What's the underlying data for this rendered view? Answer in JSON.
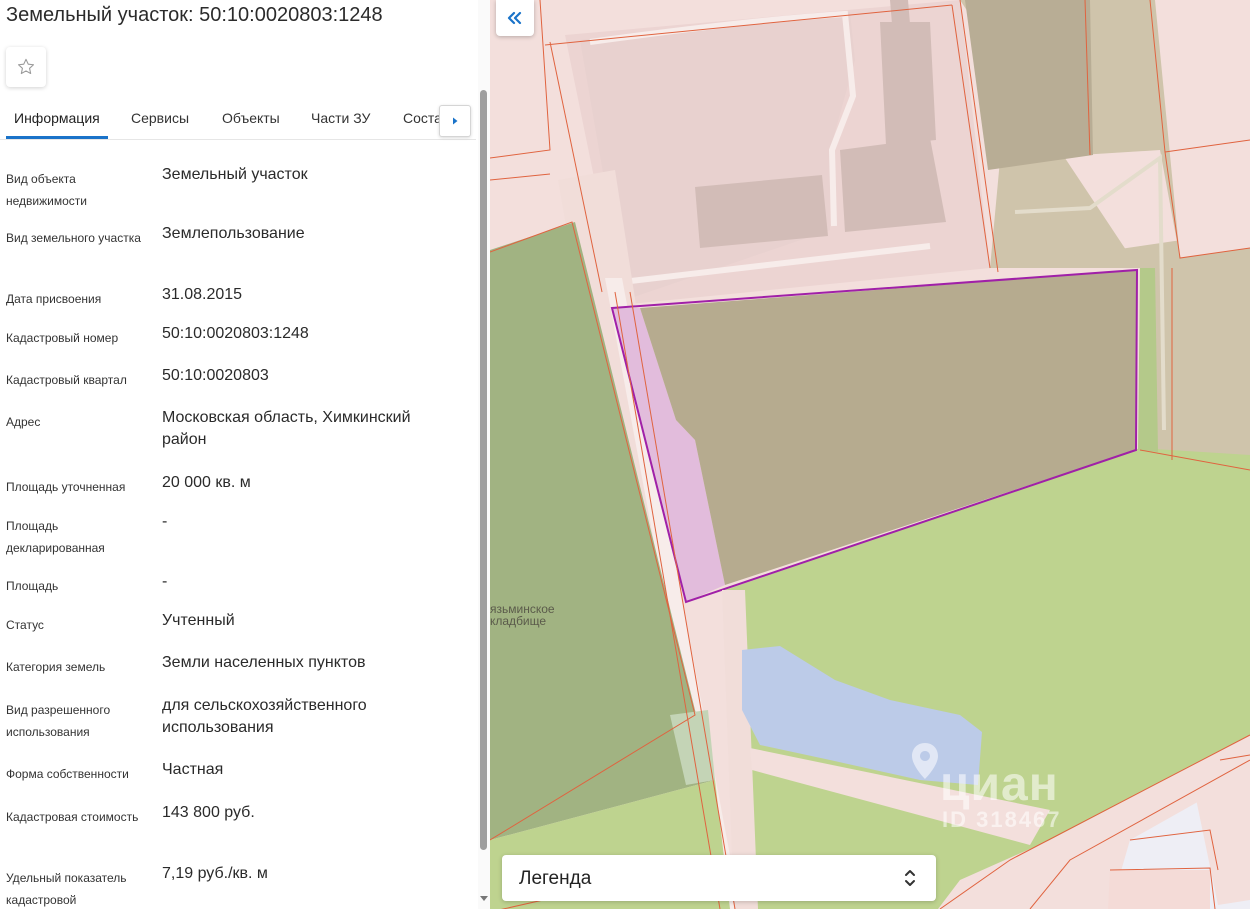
{
  "header": {
    "title": "Земельный участок: 50:10:0020803:1248"
  },
  "tabs": [
    {
      "label": "Информация",
      "active": true
    },
    {
      "label": "Сервисы"
    },
    {
      "label": "Объекты"
    },
    {
      "label": "Части ЗУ"
    },
    {
      "label": "Соста"
    }
  ],
  "properties": [
    {
      "label": "Вид объекта недвижимости",
      "value": "Земельный участок"
    },
    {
      "label": "Вид земельного участка",
      "value": "Землепользование"
    },
    {
      "label": "Дата присвоения",
      "value": "31.08.2015"
    },
    {
      "label": "Кадастровый номер",
      "value": "50:10:0020803:1248"
    },
    {
      "label": "Кадастровый квартал",
      "value": "50:10:0020803"
    },
    {
      "label": "Адрес",
      "value": "Московская область, Химкинский район"
    },
    {
      "label": "Площадь уточненная",
      "value": "20 000 кв. м"
    },
    {
      "label": "Площадь декларированная",
      "value": "-"
    },
    {
      "label": "Площадь",
      "value": "-"
    },
    {
      "label": "Статус",
      "value": "Учтенный"
    },
    {
      "label": "Категория земель",
      "value": "Земли населенных пунктов"
    },
    {
      "label": "Вид разрешенного использования",
      "value": "для сельскохозяйственного использования"
    },
    {
      "label": "Форма собственности",
      "value": "Частная"
    },
    {
      "label": "Кадастровая стоимость",
      "value": "143 800 руб."
    },
    {
      "label": "Удельный показатель кадастровой",
      "value": "7,19 руб./кв. м"
    }
  ],
  "map": {
    "place_label_line1": "язьминское",
    "place_label_line2": "кладбище",
    "legend_label": "Легенда",
    "watermark_text": "циан",
    "watermark_id": "ID 318467",
    "colors": {
      "parcel_outline": "#a020a8",
      "parcel_fill": "#b6ab8f",
      "road_fill": "#e2bcdc",
      "green": "#bed38f",
      "dark_green": "#a1b382",
      "water": "#bccbe8",
      "boundary": "#e0633f",
      "accent": "#1a73c9"
    }
  },
  "icons": {
    "favorite": "star-outline-icon",
    "tab_next": "caret-right-icon",
    "collapse": "double-chevron-left-icon",
    "legend_toggle": "chevron-up-down-icon",
    "watermark": "location-pin-icon"
  }
}
